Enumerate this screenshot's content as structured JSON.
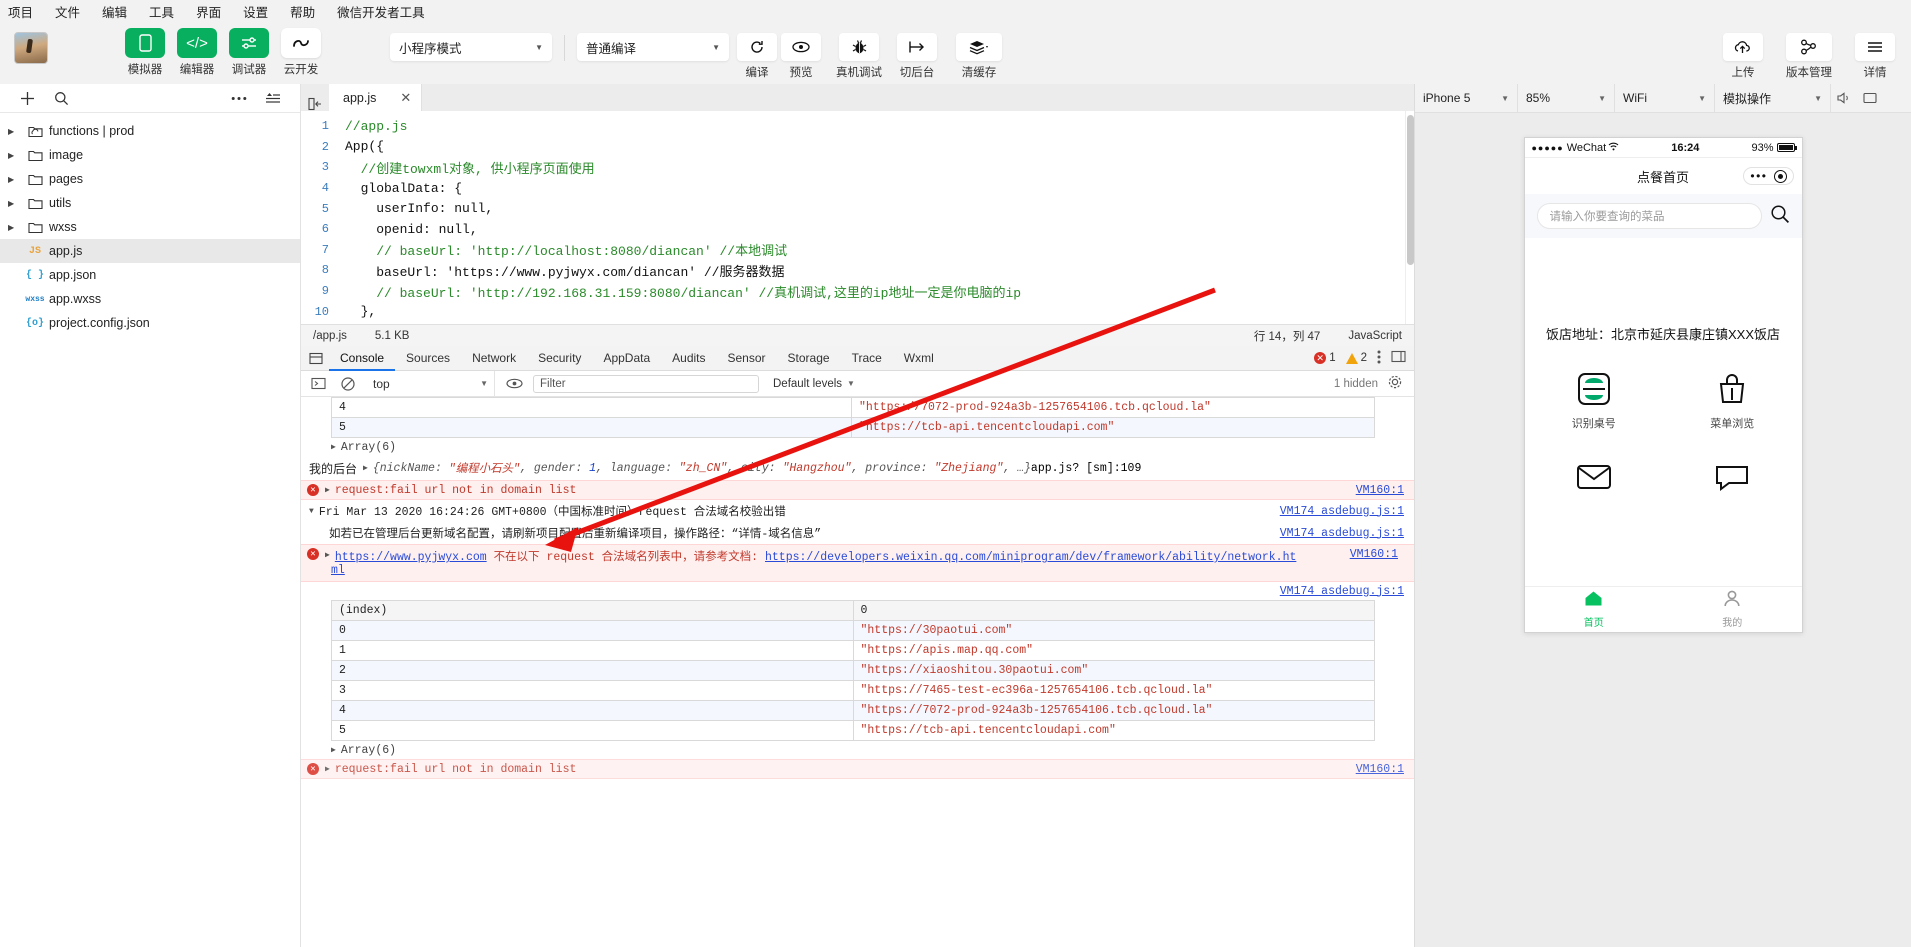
{
  "menubar": {
    "items": [
      "项目",
      "文件",
      "编辑",
      "工具",
      "界面",
      "设置",
      "帮助",
      "微信开发者工具"
    ]
  },
  "toolbar": {
    "panels": [
      {
        "label": "模拟器",
        "icon": "phone-icon",
        "style": "green"
      },
      {
        "label": "编辑器",
        "icon": "code-icon",
        "style": "green"
      },
      {
        "label": "调试器",
        "icon": "sliders-icon",
        "style": "green"
      },
      {
        "label": "云开发",
        "icon": "cloud-dev-icon",
        "style": "white"
      }
    ],
    "mode_select": "小程序模式",
    "compile_select": "普通编译",
    "actions": [
      {
        "label": "编译",
        "icon": "refresh-icon"
      },
      {
        "label": "预览",
        "icon": "eye-icon"
      },
      {
        "label": "真机调试",
        "icon": "bug-icon"
      },
      {
        "label": "切后台",
        "icon": "background-icon"
      },
      {
        "label": "清缓存",
        "icon": "layers-icon"
      }
    ],
    "right_actions": [
      {
        "label": "上传",
        "icon": "upload-cloud-icon"
      },
      {
        "label": "版本管理",
        "icon": "branch-icon"
      },
      {
        "label": "详情",
        "icon": "menu-icon"
      }
    ]
  },
  "sidebar": {
    "tools": [
      "add-icon",
      "search-icon",
      "more-icon",
      "collapse-icon",
      "sidebar-toggle-icon"
    ],
    "tree": [
      {
        "name": "functions | prod",
        "type": "folder-cloud",
        "expandable": true,
        "selected": false
      },
      {
        "name": "image",
        "type": "folder",
        "expandable": true,
        "selected": false
      },
      {
        "name": "pages",
        "type": "folder",
        "expandable": true,
        "selected": false
      },
      {
        "name": "utils",
        "type": "folder",
        "expandable": true,
        "selected": false
      },
      {
        "name": "wxss",
        "type": "folder",
        "expandable": true,
        "selected": false
      },
      {
        "name": "app.js",
        "type": "js",
        "icon_text": "JS",
        "expandable": false,
        "selected": true
      },
      {
        "name": "app.json",
        "type": "json",
        "icon_text": "{ }",
        "expandable": false,
        "selected": false
      },
      {
        "name": "app.wxss",
        "type": "wxss",
        "icon_text": "wxss",
        "expandable": false,
        "selected": false
      },
      {
        "name": "project.config.json",
        "type": "json",
        "icon_text": "{o}",
        "expandable": false,
        "selected": false
      }
    ]
  },
  "editor": {
    "tab": {
      "name": "app.js",
      "close": "✕"
    },
    "lines": [
      {
        "n": "1",
        "text": "//app.js"
      },
      {
        "n": "2",
        "text": "App({"
      },
      {
        "n": "3",
        "text": "  //创建towxml对象, 供小程序页面使用"
      },
      {
        "n": "4",
        "text": "  globalData: {"
      },
      {
        "n": "5",
        "text": "    userInfo: null,"
      },
      {
        "n": "6",
        "text": "    openid: null,"
      },
      {
        "n": "7",
        "text": "    // baseUrl: 'http://localhost:8080/diancan' //本地调试"
      },
      {
        "n": "8",
        "text": "    baseUrl: 'https://www.pyjwyx.com/diancan' //服务器数据"
      },
      {
        "n": "9",
        "text": "    // baseUrl: 'http://192.168.31.159:8080/diancan' //真机调试,这里的ip地址一定是你电脑的ip"
      },
      {
        "n": "10",
        "text": "  },"
      }
    ],
    "status": {
      "path": "/app.js",
      "size": "5.1 KB",
      "position": "行 14，列 47",
      "language": "JavaScript"
    }
  },
  "devtools": {
    "tabs": [
      "Console",
      "Sources",
      "Network",
      "Security",
      "AppData",
      "Audits",
      "Sensor",
      "Storage",
      "Trace",
      "Wxml"
    ],
    "active_tab": "Console",
    "error_count": "1",
    "warning_count": "2",
    "filter": {
      "context": "top",
      "placeholder": "Filter",
      "levels": "Default levels",
      "hidden": "1 hidden"
    },
    "top_rows": [
      {
        "index": "4",
        "value": "\"https://7072-prod-924a3b-1257654106.tcb.qcloud.la\""
      },
      {
        "index": "5",
        "value": "\"https://tcb-api.tencentcloudapi.com\""
      }
    ],
    "array_label": "Array(6)",
    "user_log": {
      "label": "我的后台",
      "nickName_key": "nickName",
      "nickName_val": "\"编程小石头\"",
      "gender_key": "gender",
      "gender_val": "1",
      "language_key": "language",
      "language_val": "\"zh_CN\"",
      "city_key": "city",
      "city_val": "\"Hangzhou\"",
      "province_key": "province",
      "province_val": "\"Zhejiang\"",
      "ellipsis": ", …}",
      "source": "app.js? [sm]:109"
    },
    "errors": [
      {
        "text": "request:fail url not in domain list",
        "source": "VM160:1"
      }
    ],
    "group": {
      "header": "Fri Mar 13 2020 16:24:26 GMT+0800（中国标准时间）request 合法域名校验出错",
      "header_source": "VM174 asdebug.js:1",
      "detail": "如若已在管理后台更新域名配置，请刷新项目配置后重新编译项目，操作路径：“详情-域名信息”",
      "detail_source": "VM174 asdebug.js:1"
    },
    "domain_error": {
      "url": "https://www.pyjwyx.com",
      "mid": "不在以下 request 合法域名列表中，请参考文档:",
      "doc_url": "https://developers.weixin.qq.com/miniprogram/dev/framework/ability/network.ht",
      "doc_url_tail": "ml",
      "source": "VM160:1"
    },
    "table_source": "VM174 asdebug.js:1",
    "table": {
      "headers": [
        "(index)",
        "0"
      ],
      "rows": [
        {
          "index": "0",
          "value": "\"https://30paotui.com\""
        },
        {
          "index": "1",
          "value": "\"https://apis.map.qq.com\""
        },
        {
          "index": "2",
          "value": "\"https://xiaoshitou.30paotui.com\""
        },
        {
          "index": "3",
          "value": "\"https://7465-test-ec396a-1257654106.tcb.qcloud.la\""
        },
        {
          "index": "4",
          "value": "\"https://7072-prod-924a3b-1257654106.tcb.qcloud.la\""
        },
        {
          "index": "5",
          "value": "\"https://tcb-api.tencentcloudapi.com\""
        }
      ]
    },
    "bottom_array_label": "Array(6)"
  },
  "simulator": {
    "device": "iPhone 5",
    "zoom": "85%",
    "network": "WiFi",
    "action": "模拟操作",
    "phone": {
      "carrier": "WeChat",
      "signal_dots": "●●●●●",
      "wifi_icon": "wifi-icon",
      "time": "16:24",
      "battery": "93%",
      "nav_title": "点餐首页",
      "search_placeholder": "请输入你要查询的菜品",
      "address": "饭店地址：北京市延庆县康庄镇XXX饭店",
      "grid": [
        {
          "label": "识别桌号",
          "icon": "scan-table-icon"
        },
        {
          "label": "菜单浏览",
          "icon": "menu-browse-icon"
        },
        {
          "label": "",
          "icon": "mail-icon"
        },
        {
          "label": "",
          "icon": "chat-icon"
        }
      ],
      "tabs": [
        {
          "label": "首页",
          "icon": "home-icon",
          "active": true
        },
        {
          "label": "我的",
          "icon": "user-icon",
          "active": false
        }
      ]
    }
  },
  "colors": {
    "brand_green": "#07af5e",
    "tab_active_blue": "#1a73e8",
    "error_red": "#d93025",
    "annotation_red": "#e8130f"
  }
}
